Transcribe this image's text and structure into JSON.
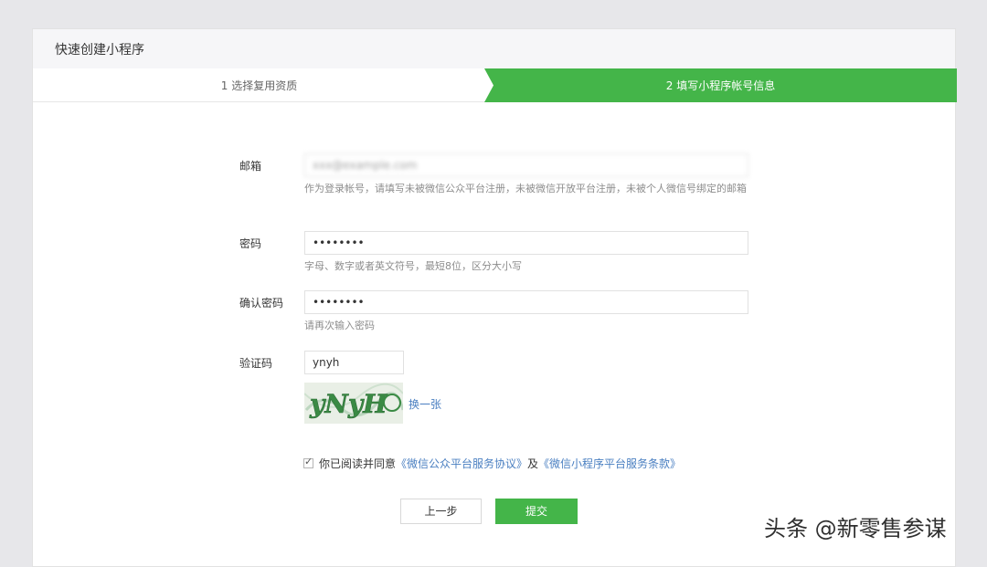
{
  "header": {
    "title": "快速创建小程序"
  },
  "steps": [
    {
      "label": "1 选择复用资质",
      "state": "done"
    },
    {
      "label": "2 填写小程序帐号信息",
      "state": "active"
    }
  ],
  "form": {
    "email": {
      "label": "邮箱",
      "value": "xxx@example.com",
      "hint": "作为登录帐号，请填写未被微信公众平台注册，未被微信开放平台注册，未被个人微信号绑定的邮箱"
    },
    "password": {
      "label": "密码",
      "value": "••••••••",
      "hint": "字母、数字或者英文符号，最短8位，区分大小写"
    },
    "confirm": {
      "label": "确认密码",
      "value": "••••••••",
      "hint": "请再次输入密码"
    },
    "captcha": {
      "label": "验证码",
      "value": "ynyh",
      "image_text": "yNyH",
      "refresh": "换一张"
    }
  },
  "agreement": {
    "checked": true,
    "prefix": "你已阅读并同意",
    "link1": "《微信公众平台服务协议》",
    "and": "及",
    "link2": "《微信小程序平台服务条款》"
  },
  "buttons": {
    "prev": "上一步",
    "submit": "提交"
  },
  "watermark": "头条 @新零售参谋",
  "colors": {
    "accent": "#44b549",
    "link": "#4a7fc1",
    "background": "#e7e7ea"
  }
}
